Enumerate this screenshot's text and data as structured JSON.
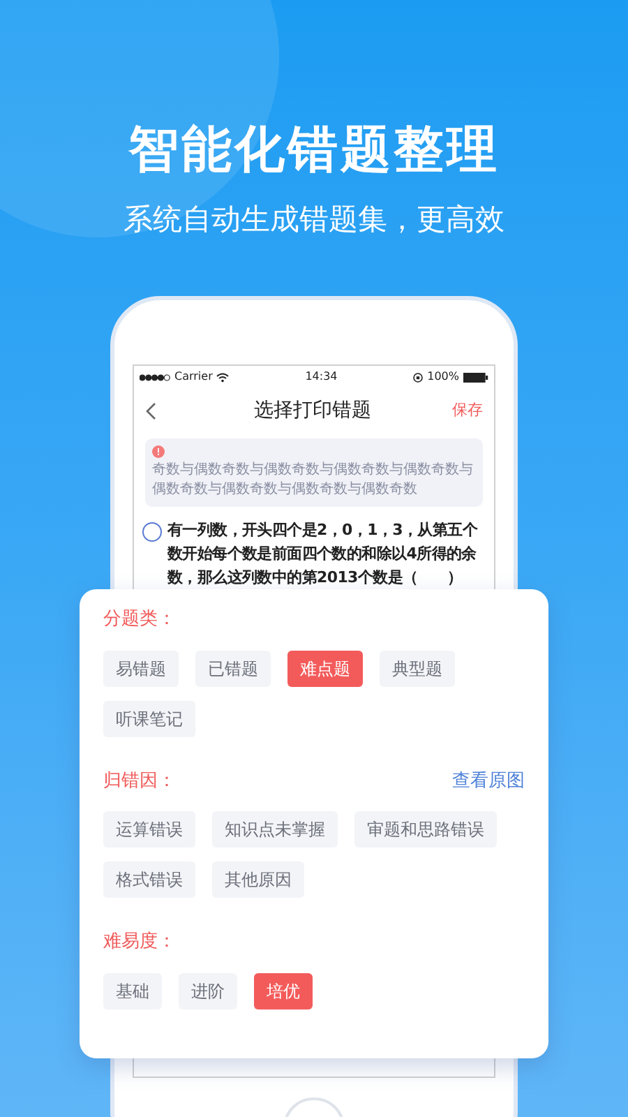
{
  "headline": "智能化错题整理",
  "subheadline": "系统自动生成错题集，更高效",
  "status_bar": {
    "carrier": "Carrier",
    "time": "14:34",
    "battery": "100%"
  },
  "nav": {
    "title": "选择打印错题",
    "action": "保存"
  },
  "note": {
    "text": "奇数与偶数奇数与偶数奇数与偶数奇数与偶数奇数与偶数奇数与偶数奇数与偶数奇数与偶数奇数"
  },
  "question": {
    "selected": false,
    "text": "有一列数，开头四个是2，0，1，3，从第五个数开始每个数是前面四个数的和除以4所得的余数，那么这列数中的第2013个数是（　　）"
  },
  "sections": [
    {
      "title": "分题类：",
      "options": [
        {
          "label": "易错题",
          "selected": false
        },
        {
          "label": "已错题",
          "selected": false
        },
        {
          "label": "难点题",
          "selected": true
        },
        {
          "label": "典型题",
          "selected": false
        },
        {
          "label": "听课笔记",
          "selected": false
        }
      ]
    },
    {
      "title": "归错因：",
      "link": "查看原图",
      "options": [
        {
          "label": "运算错误",
          "selected": false
        },
        {
          "label": "知识点未掌握",
          "selected": false
        },
        {
          "label": "审题和思路错误",
          "selected": false
        },
        {
          "label": "格式错误",
          "selected": false
        },
        {
          "label": "其他原因",
          "selected": false
        }
      ]
    },
    {
      "title": "难易度：",
      "options": [
        {
          "label": "基础",
          "selected": false
        },
        {
          "label": "进阶",
          "selected": false
        },
        {
          "label": "培优",
          "selected": true
        }
      ]
    }
  ]
}
